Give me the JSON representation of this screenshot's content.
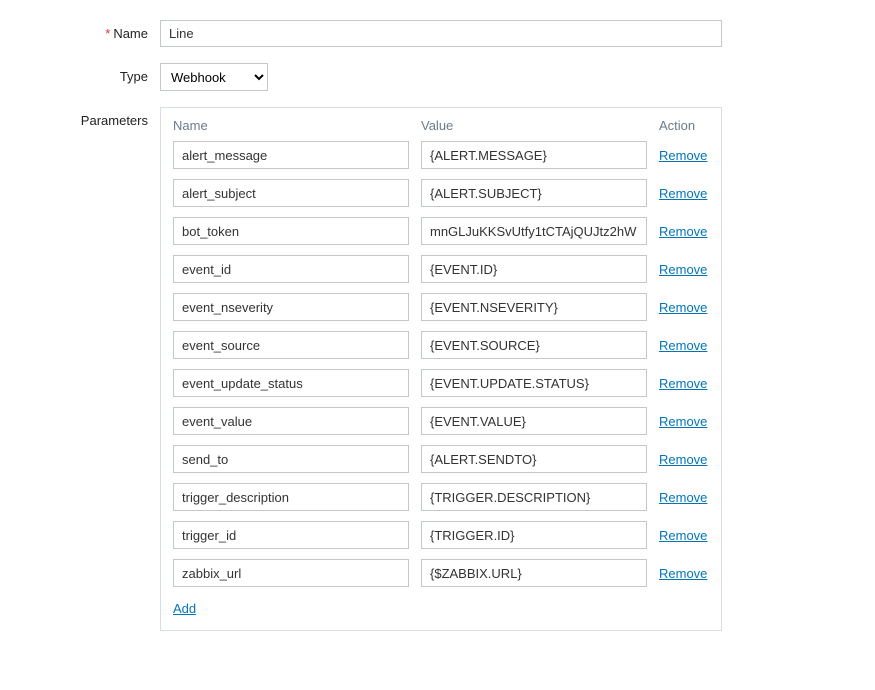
{
  "name_field": {
    "label": "Name",
    "required": true,
    "value": "Line"
  },
  "type_field": {
    "label": "Type",
    "selected": "Webhook"
  },
  "parameters_label": "Parameters",
  "params_header": {
    "name": "Name",
    "value": "Value",
    "action": "Action"
  },
  "parameters": [
    {
      "name": "alert_message",
      "value": "{ALERT.MESSAGE}"
    },
    {
      "name": "alert_subject",
      "value": "{ALERT.SUBJECT}"
    },
    {
      "name": "bot_token",
      "value": "mnGLJuKKSvUtfy1tCTAjQUJtz2hW"
    },
    {
      "name": "event_id",
      "value": "{EVENT.ID}"
    },
    {
      "name": "event_nseverity",
      "value": "{EVENT.NSEVERITY}"
    },
    {
      "name": "event_source",
      "value": "{EVENT.SOURCE}"
    },
    {
      "name": "event_update_status",
      "value": "{EVENT.UPDATE.STATUS}"
    },
    {
      "name": "event_value",
      "value": "{EVENT.VALUE}"
    },
    {
      "name": "send_to",
      "value": "{ALERT.SENDTO}"
    },
    {
      "name": "trigger_description",
      "value": "{TRIGGER.DESCRIPTION}"
    },
    {
      "name": "trigger_id",
      "value": "{TRIGGER.ID}"
    },
    {
      "name": "zabbix_url",
      "value": "{$ZABBIX.URL}"
    }
  ],
  "remove_label": "Remove",
  "add_label": "Add"
}
